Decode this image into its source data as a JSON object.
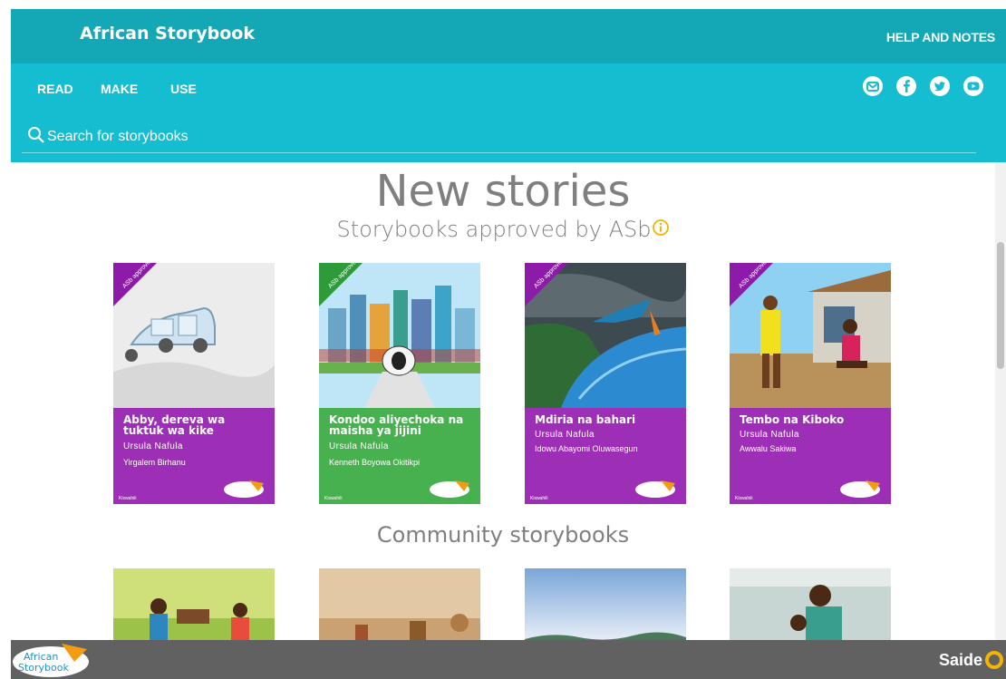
{
  "header": {
    "brand": "African Storybook",
    "help_label": "HELP AND NOTES"
  },
  "nav": {
    "items": [
      {
        "label": "READ"
      },
      {
        "label": "MAKE"
      },
      {
        "label": "USE"
      }
    ],
    "social": [
      "email-icon",
      "facebook-icon",
      "twitter-icon",
      "youtube-icon"
    ]
  },
  "search": {
    "placeholder": "Search for storybooks"
  },
  "new_stories": {
    "heading": "New stories",
    "subheading": "Storybooks approved by ASb",
    "ribbon_text": "ASb approved",
    "books": [
      {
        "title": "Abby, dereva wa tuktuk wa kike",
        "author": "Ursula Nafula",
        "illustrator": "Yirgalem Birhanu",
        "language": "Kiswahili",
        "color": "#9d2fb6"
      },
      {
        "title": "Kondoo aliyechoka na maisha ya jijini",
        "author": "Ursula Nafula",
        "illustrator": "Kenneth Boyowa Okitikpi",
        "language": "Kiswahili",
        "color": "#46b14e"
      },
      {
        "title": "Mdiria na bahari",
        "author": "Ursula Nafula",
        "illustrator": "Idowu Abayomi Oluwasegun",
        "language": "Kiswahili",
        "color": "#9d2fb6"
      },
      {
        "title": "Tembo na Kiboko",
        "author": "Ursula Nafula",
        "illustrator": "Awwalu Sakiwa",
        "language": "Kiswahili",
        "color": "#9d2fb6"
      }
    ]
  },
  "community": {
    "heading": "Community storybooks"
  },
  "footer": {
    "logo_line1": "African",
    "logo_line2": "Storybook",
    "partner": "Saide"
  },
  "colors": {
    "topbar": "#14a8b7",
    "navband": "#14bdd0",
    "footer": "#616161",
    "heading": "#7f7f7f"
  }
}
